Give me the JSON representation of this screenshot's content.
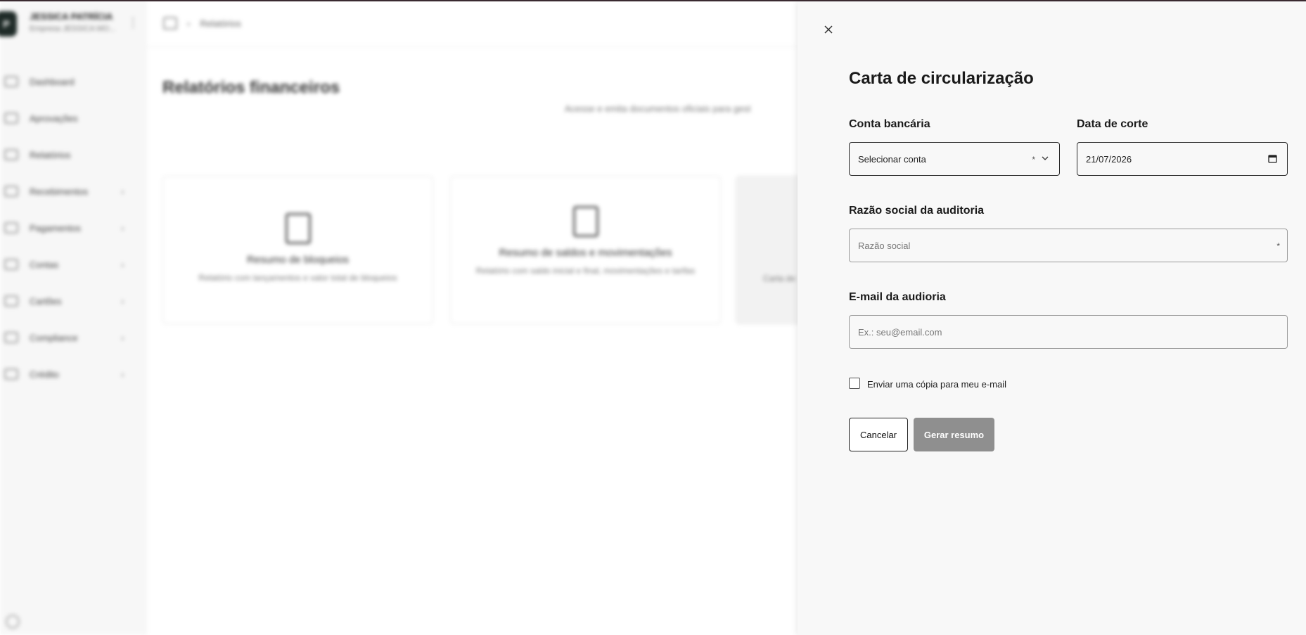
{
  "sidebar": {
    "user_name": "JESSICA PATRÍCIA",
    "user_sub": "Empresa JESSICA MO...",
    "items": [
      {
        "label": "Dashboard",
        "icon": "home-icon",
        "has_children": false
      },
      {
        "label": "Aprovações",
        "icon": "checkbox-icon",
        "has_children": false
      },
      {
        "label": "Relatórios",
        "icon": "chart-icon",
        "has_children": false
      },
      {
        "label": "Recebimentos",
        "icon": "document-icon",
        "has_children": true
      },
      {
        "label": "Pagamentos",
        "icon": "document-icon",
        "has_children": true
      },
      {
        "label": "Contas",
        "icon": "bank-icon",
        "has_children": true
      },
      {
        "label": "Cartões",
        "icon": "card-icon",
        "has_children": true
      },
      {
        "label": "Compliance",
        "icon": "monitor-icon",
        "has_children": true
      },
      {
        "label": "Crédito",
        "icon": "credit-icon",
        "has_children": true
      }
    ]
  },
  "breadcrumb": {
    "current": "Relatórios"
  },
  "page": {
    "title": "Relatórios financeiros",
    "subtitle": "Acesse e emita documentos oficiais para gest"
  },
  "cards": [
    {
      "title": "Resumo de bloqueios",
      "desc": "Relatório com lançamentos e valor total de bloqueios"
    },
    {
      "title": "Resumo de saldos e movimentações",
      "desc": "Relatório com saldo inicial e final, movimentações e tarifas"
    },
    {
      "title": "",
      "desc": "Carta de"
    }
  ],
  "drawer": {
    "title": "Carta de circularização",
    "bank_account": {
      "label": "Conta bancária",
      "value": "Selecionar conta",
      "required_mark": "*"
    },
    "cutoff_date": {
      "label": "Data de corte",
      "value": "21/07/2026"
    },
    "audit_name": {
      "label": "Razão social da auditoria",
      "placeholder": "Razão social",
      "required_mark": "*"
    },
    "audit_email": {
      "label": "E-mail da audioria",
      "placeholder": "Ex.: seu@email.com"
    },
    "copy_checkbox": {
      "label": "Enviar uma cópia para meu e-mail",
      "checked": false
    },
    "cancel_label": "Cancelar",
    "generate_label": "Gerar resumo"
  },
  "colors": {
    "primary_button_disabled": "#8f8f8f",
    "drawer_bg": "#f8f8f8",
    "brand_dark": "#1f2b28"
  }
}
